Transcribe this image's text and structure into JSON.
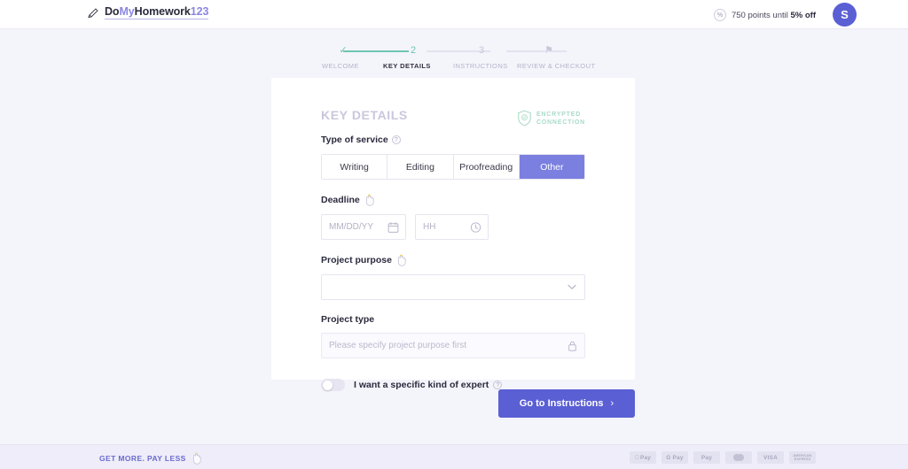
{
  "header": {
    "logo": {
      "part1": "Do",
      "part2": "My",
      "part3": "Homework",
      "part4": "123"
    },
    "points_prefix": "750 points until ",
    "points_highlight": "5% off",
    "percent_glyph": "%",
    "avatar_initial": "S"
  },
  "stepper": {
    "steps": [
      {
        "mark": "✓",
        "label": "WELCOME",
        "state": "done"
      },
      {
        "mark": "2",
        "label": "KEY DETAILS",
        "state": "active"
      },
      {
        "mark": "3",
        "label": "INSTRUCTIONS",
        "state": "pending"
      },
      {
        "mark": "⚑",
        "label": "REVIEW & CHECKOUT",
        "state": "pending"
      }
    ]
  },
  "card": {
    "title": "KEY DETAILS",
    "encrypted_line1": "ENCRYPTED",
    "encrypted_line2": "CONNECTION",
    "service": {
      "label": "Type of service",
      "help_glyph": "?",
      "options": [
        "Writing",
        "Editing",
        "Proofreading",
        "Other"
      ],
      "selected": "Other"
    },
    "deadline": {
      "label": "Deadline",
      "date_placeholder": "MM/DD/YY",
      "date_value": "",
      "time_placeholder": "HH",
      "time_value": ""
    },
    "project_purpose": {
      "label": "Project purpose",
      "value": "",
      "placeholder": ""
    },
    "project_type": {
      "label": "Project type",
      "placeholder": "Please specify project purpose first",
      "value": "",
      "locked": true
    },
    "expert_toggle": {
      "label": "I want a specific kind of expert",
      "help_glyph": "?",
      "on": false
    }
  },
  "cta": {
    "label": "Go to Instructions",
    "arrow": "›"
  },
  "footer": {
    "tagline": "GET MORE. PAY LESS",
    "payments": [
      "Pay",
      "G Pay",
      "Pay",
      "mastercard",
      "VISA",
      "AMERICAN EXPRESS"
    ],
    "apple_glyph": ""
  },
  "colors": {
    "brand_purple": "#5b5fd4",
    "tab_purple": "#7b7fe0",
    "step_green": "#6fc5b0",
    "encrypted_green": "#a9dac9",
    "page_bg": "#f4f4fb"
  }
}
